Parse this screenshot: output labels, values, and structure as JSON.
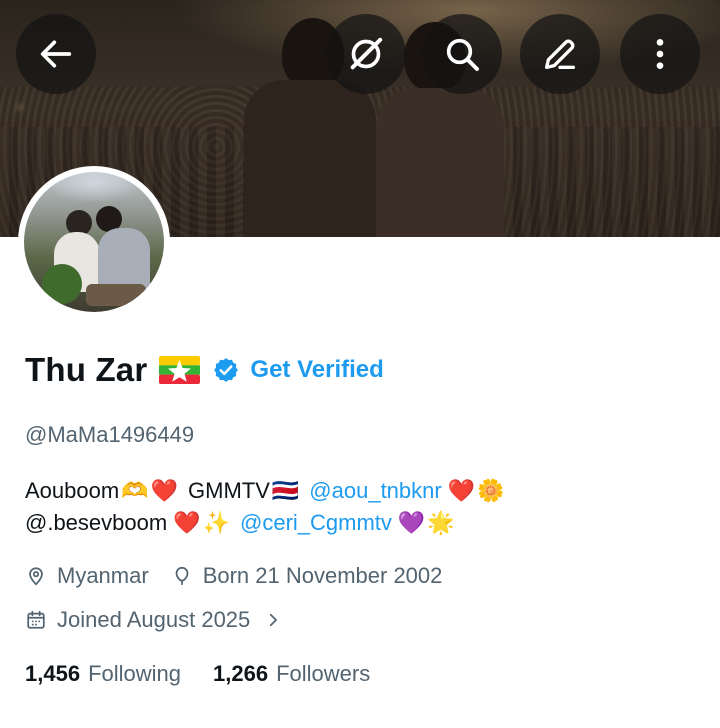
{
  "header": {
    "back": "back-icon",
    "actions": [
      "grok-icon",
      "search-icon",
      "edit-icon",
      "more-icon"
    ]
  },
  "profile": {
    "display_name": "Thu Zar",
    "flag_emoji": "myanmar-flag",
    "get_verified": "Get Verified",
    "handle": "@MaMa1496449",
    "bio": {
      "line1": {
        "text1": "Aouboom",
        "emoji1": "🫶",
        "emoji2": "❤️",
        "text2": "GMMTV",
        "emoji3": "🇨🇷",
        "mention1": "@aou_tnbknr",
        "emoji4": "❤️",
        "emoji5": "🌼"
      },
      "line2": {
        "text1": "@.besevboom",
        "emoji1": "❤️",
        "emoji2": "✨",
        "mention2": "@ceri_Cgmmtv",
        "emoji3": "💜",
        "emoji4": "🌟"
      }
    },
    "location": "Myanmar",
    "birthday": "Born 21 November 2002",
    "joined": "Joined August 2025",
    "following_count": "1,456",
    "following_label": "Following",
    "followers_count": "1,266",
    "followers_label": "Followers"
  },
  "colors": {
    "accent": "#1d9bf0",
    "secondary_text": "#536471",
    "primary_text": "#0f1419"
  }
}
